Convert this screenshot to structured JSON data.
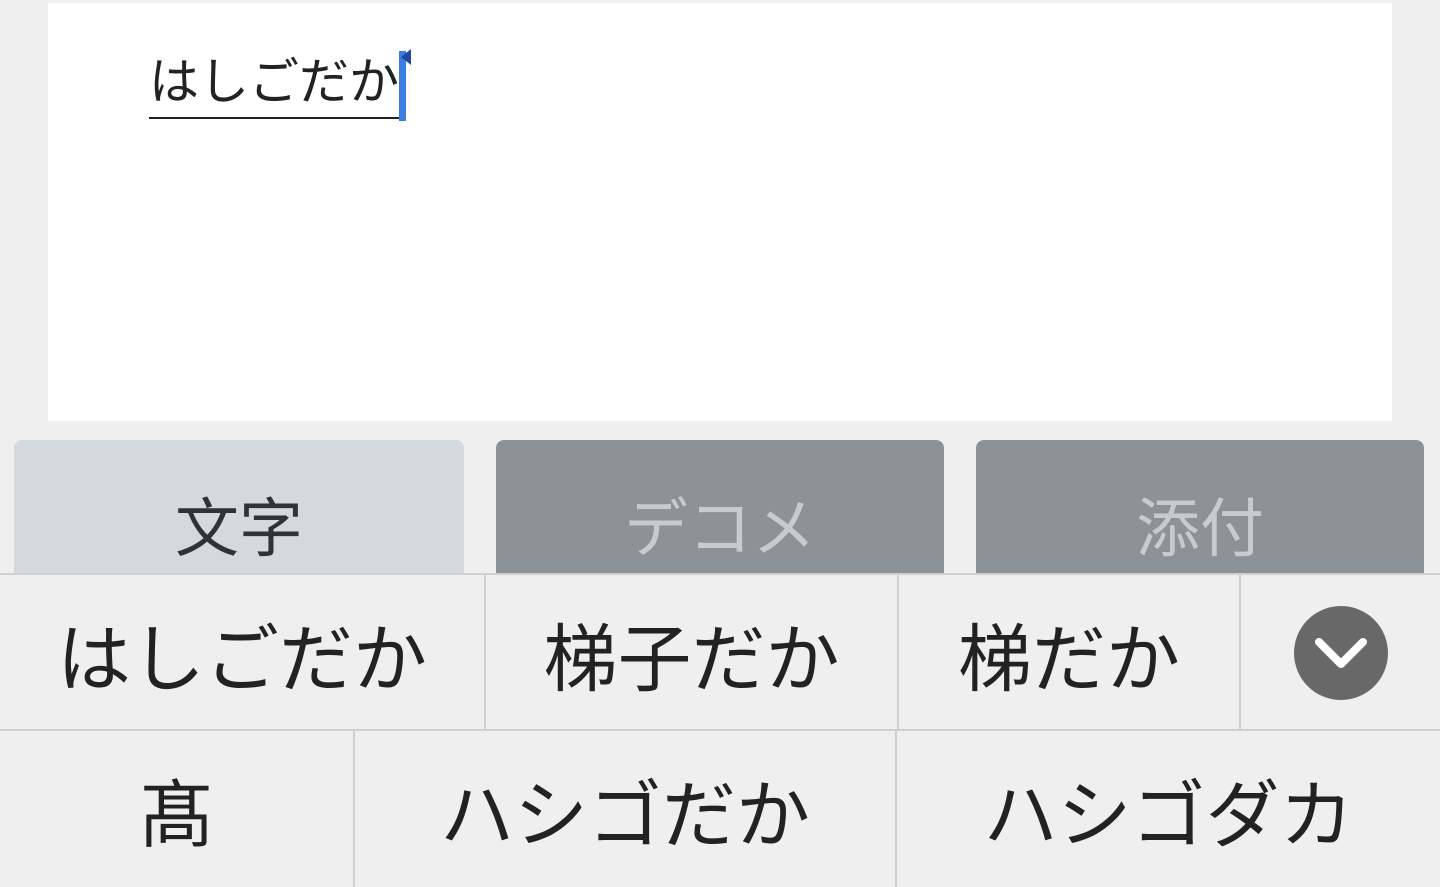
{
  "editor": {
    "composing_text": "はしごだか"
  },
  "tabs": [
    {
      "label": "文字",
      "active": true
    },
    {
      "label": "デコメ",
      "active": false
    },
    {
      "label": "添付",
      "active": false
    }
  ],
  "candidates": {
    "row1": [
      "はしごだか",
      "梯子だか",
      "梯だか"
    ],
    "row2": [
      "髙",
      "ハシゴだか",
      "ハシゴダカ"
    ]
  },
  "icons": {
    "expand": "chevron-down-icon",
    "cursor": "text-cursor-icon"
  },
  "colors": {
    "cursor": "#3b7de0",
    "tab_active_bg": "#d5d9dc",
    "tab_inactive_bg": "#8c9398",
    "expand_button_bg": "#686868"
  }
}
